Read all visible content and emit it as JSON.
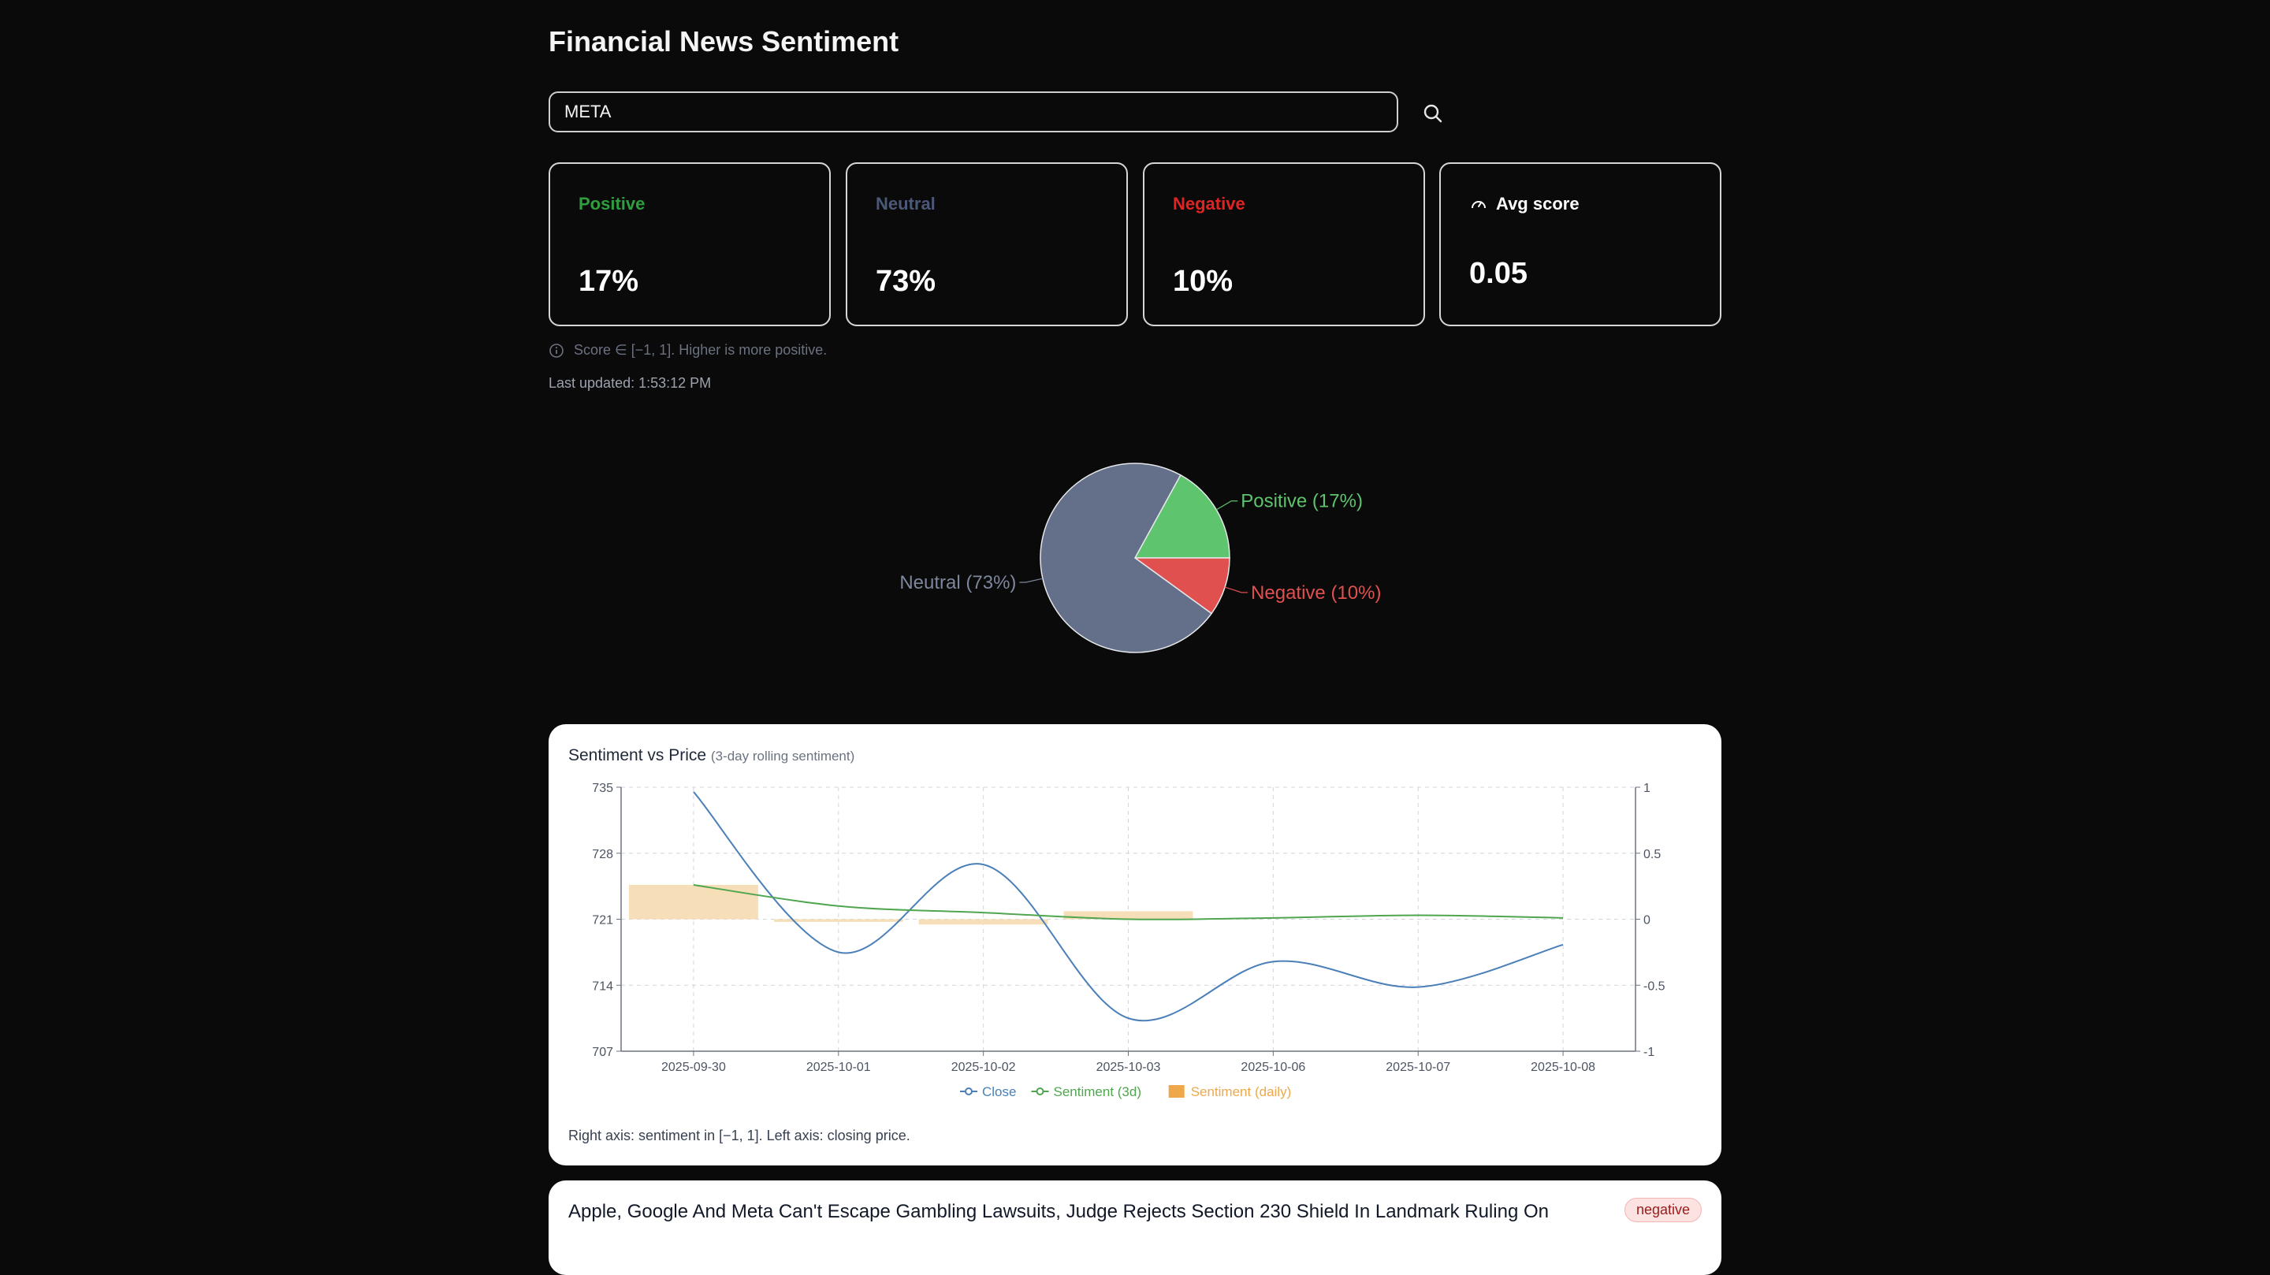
{
  "app": {
    "title": "Financial News Sentiment"
  },
  "search": {
    "value": "META",
    "icon": "search-icon"
  },
  "cards": [
    {
      "label": "Positive",
      "value": "17%",
      "color": "#2e9e3f"
    },
    {
      "label": "Neutral",
      "value": "73%",
      "color": "#4b5878"
    },
    {
      "label": "Negative",
      "value": "10%",
      "color": "#e02424"
    },
    {
      "label": "Avg score",
      "value": "0.05",
      "color": "#ffffff",
      "icon": "gauge-icon"
    }
  ],
  "score_note": "Score ∈ [−1, 1]. Higher is more positive.",
  "last_updated": "Last updated: 1:53:12 PM",
  "pie": {
    "slices": [
      {
        "label": "Positive (17%)",
        "value": 17,
        "color": "#5ec46e",
        "text_color": "#5ec46e"
      },
      {
        "label": "Negative (10%)",
        "value": 10,
        "color": "#e0504f",
        "text_color": "#e0504f"
      },
      {
        "label": "Neutral (73%)",
        "value": 73,
        "color": "#64708a",
        "text_color": "#7d879c"
      }
    ]
  },
  "panel": {
    "title": "Sentiment vs Price",
    "subtitle": "(3-day rolling sentiment)",
    "footnote": "Right axis: sentiment in [−1, 1]. Left axis: closing price."
  },
  "chart_data": {
    "type": "line",
    "title": "Sentiment vs Price",
    "subtitle": "(3-day rolling sentiment)",
    "categories": [
      "2025-09-30",
      "2025-10-01",
      "2025-10-02",
      "2025-10-03",
      "2025-10-06",
      "2025-10-07",
      "2025-10-08"
    ],
    "series": [
      {
        "name": "Close",
        "axis": "left",
        "kind": "line",
        "color": "#4a7fb8",
        "values": [
          734.5,
          717.5,
          726.8,
          710.5,
          716.5,
          713.8,
          718.3
        ]
      },
      {
        "name": "Sentiment (3d)",
        "axis": "right",
        "kind": "line",
        "color": "#4fa64f",
        "values": [
          0.26,
          0.1,
          0.05,
          0.0,
          0.01,
          0.03,
          0.01
        ]
      },
      {
        "name": "Sentiment (daily)",
        "axis": "right",
        "kind": "bar",
        "color": "#f5deb8",
        "legend_color": "#eea849",
        "values": [
          0.26,
          -0.02,
          -0.04,
          0.06,
          0,
          0,
          0
        ]
      }
    ],
    "y_left": {
      "ylim": [
        707,
        735
      ],
      "ticks": [
        707,
        714,
        721,
        728,
        735
      ]
    },
    "y_right": {
      "ylim": [
        -1,
        1
      ],
      "ticks": [
        -1,
        -0.5,
        0,
        0.5,
        1
      ]
    },
    "grid": true,
    "legend_position": "bottom-center"
  },
  "news": [
    {
      "title": "Apple, Google And Meta Can't Escape Gambling Lawsuits, Judge Rejects Section 230 Shield In Landmark Ruling On",
      "sentiment": "negative"
    }
  ]
}
